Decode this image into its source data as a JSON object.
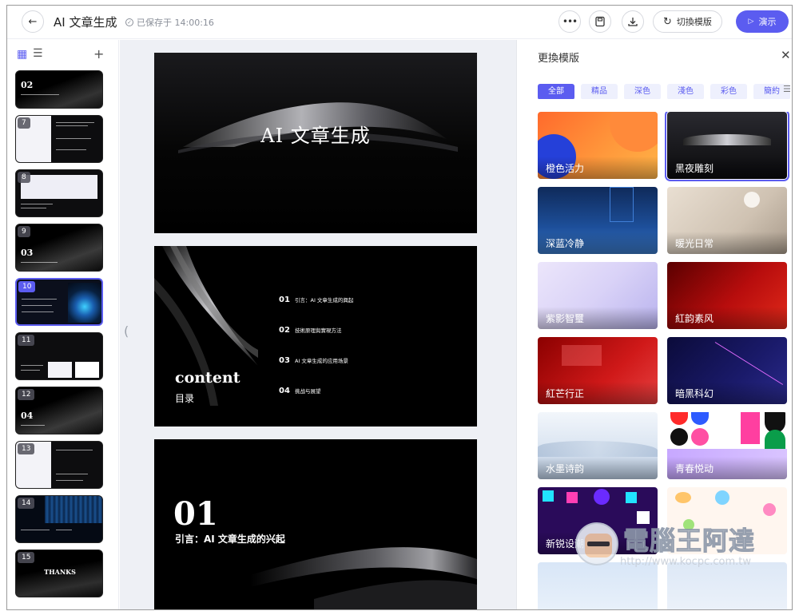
{
  "header": {
    "back_icon": "arrow-left-icon",
    "title": "AI 文章生成",
    "saved_status": "已保存于 14:00:16",
    "more_icon": "ellipsis-icon",
    "save_icon": "floppy-icon",
    "download_icon": "download-icon",
    "switch_template_label": "切換模版",
    "present_label": "演示",
    "accent_color": "#5b5cf0"
  },
  "left_panel": {
    "grid_view_icon": "grid-icon",
    "list_view_icon": "list-icon",
    "add_icon": "plus-icon",
    "slides": [
      {
        "num": "",
        "big": "02"
      },
      {
        "num": "7",
        "big": ""
      },
      {
        "num": "8",
        "big": ""
      },
      {
        "num": "9",
        "big": "03"
      },
      {
        "num": "10",
        "big": ""
      },
      {
        "num": "11",
        "big": ""
      },
      {
        "num": "12",
        "big": "04"
      },
      {
        "num": "13",
        "big": ""
      },
      {
        "num": "14",
        "big": ""
      },
      {
        "num": "15",
        "big": "THANKS"
      }
    ],
    "active_slide": "10"
  },
  "canvas": {
    "slide1_title": "AI 文章生成",
    "slide2": {
      "heading": "content",
      "subheading": "目录",
      "toc": [
        {
          "num": "01",
          "text": "引言：AI 文章生成的興起"
        },
        {
          "num": "02",
          "text": "技術原理與實現方法"
        },
        {
          "num": "03",
          "text": "AI 文章生成的应用场景"
        },
        {
          "num": "04",
          "text": "挑战与展望"
        }
      ]
    },
    "slide3": {
      "num": "01",
      "title": "引言：AI 文章生成的兴起"
    }
  },
  "right_panel": {
    "title": "更換模版",
    "close_icon": "close-icon",
    "filters": [
      "全部",
      "精品",
      "深色",
      "淺色",
      "彩色",
      "簡約"
    ],
    "active_filter": "全部",
    "templates": [
      {
        "label": "橙色活力"
      },
      {
        "label": "黑夜雕刻"
      },
      {
        "label": "深蓝冷静"
      },
      {
        "label": "暖光日常"
      },
      {
        "label": "紫影智璽"
      },
      {
        "label": "紅韵素风"
      },
      {
        "label": "紅芒行正"
      },
      {
        "label": "暗黑科幻"
      },
      {
        "label": "水墨诗韵"
      },
      {
        "label": "青春悦动"
      },
      {
        "label": "新锐设潮"
      },
      {
        "label": ""
      },
      {
        "label": ""
      },
      {
        "label": ""
      }
    ],
    "selected_template": "黑夜雕刻"
  },
  "watermark": {
    "title": "電腦王阿達",
    "url": "http://www.kocpc.com.tw"
  }
}
